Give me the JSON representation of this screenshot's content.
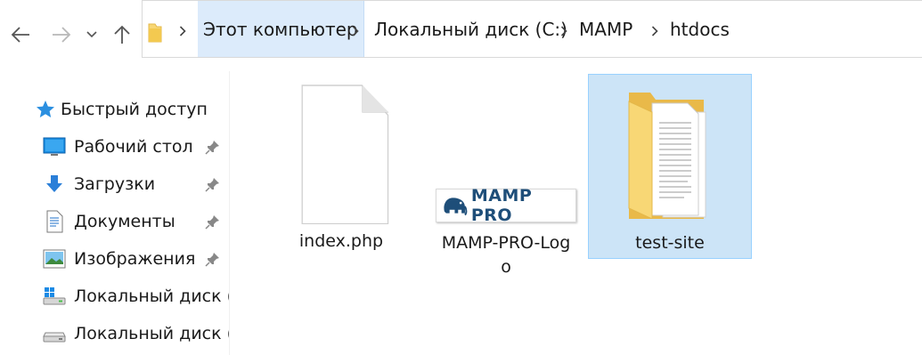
{
  "window": {
    "nav": {
      "back_icon": "arrow-left-icon",
      "forward_icon": "arrow-right-icon",
      "recent_icon": "chevron-down-icon",
      "up_icon": "arrow-up-icon"
    },
    "address_bar": {
      "folder_icon": "folder-icon",
      "breadcrumbs": [
        "Этот компьютер",
        "Локальный диск (C:)",
        "MAMP",
        "htdocs"
      ]
    }
  },
  "sidebar": {
    "items": [
      {
        "label": "Быстрый доступ",
        "icon": "star-icon",
        "pinned": false
      },
      {
        "label": "Рабочий стол",
        "icon": "desktop-icon",
        "pinned": true
      },
      {
        "label": "Загрузки",
        "icon": "download-arrow-icon",
        "pinned": true
      },
      {
        "label": "Документы",
        "icon": "documents-icon",
        "pinned": true
      },
      {
        "label": "Изображения",
        "icon": "pictures-icon",
        "pinned": true
      },
      {
        "label": "Локальный диск (C",
        "icon": "windows-drive-icon",
        "pinned": false
      },
      {
        "label": "Локальный диск (I",
        "icon": "drive-icon",
        "pinned": false
      }
    ]
  },
  "files": [
    {
      "name": "index.php",
      "icon": "blank-file-icon",
      "selected": false
    },
    {
      "name_line1": "MAMP-PRO-Log",
      "name_line2": "o",
      "icon": "mamp-pro-logo-image",
      "logo_text": "MAMP PRO",
      "selected": false
    },
    {
      "name": "test-site",
      "icon": "folder-with-documents-icon",
      "selected": true
    }
  ],
  "colors": {
    "selection_bg": "#cce4f7",
    "selection_border": "#99d1ff",
    "breadcrumb_active": "#dcebfb",
    "folder_yellow": "#f8d775",
    "mamp_blue": "#1e4e79"
  }
}
